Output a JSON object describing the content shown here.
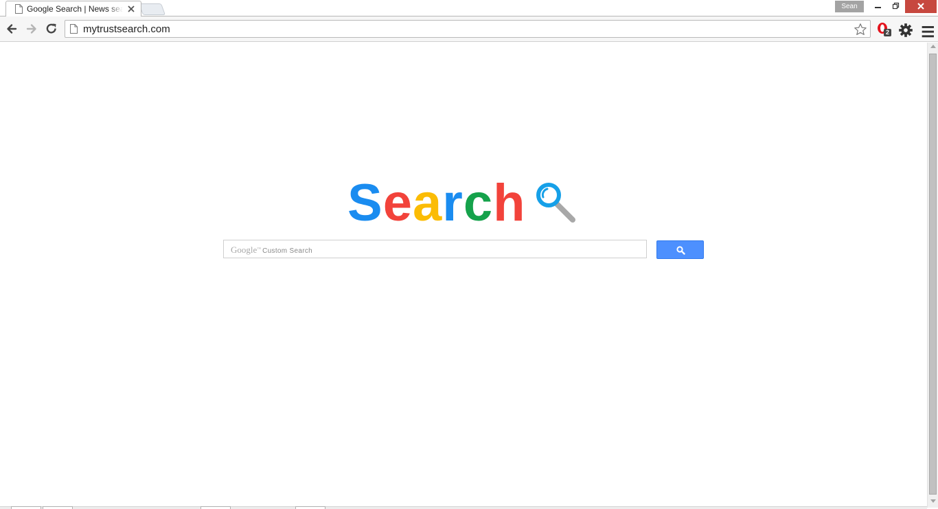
{
  "browser": {
    "tab": {
      "title": "Google Search | News search"
    },
    "profile_name": "Sean",
    "address": "mytrustsearch.com",
    "extension_badge": "2"
  },
  "page": {
    "logo": {
      "letters": [
        {
          "char": "S",
          "color": "#1a8cf0"
        },
        {
          "char": "e",
          "color": "#f2433b"
        },
        {
          "char": "a",
          "color": "#fbbc05"
        },
        {
          "char": "r",
          "color": "#1a8cf0"
        },
        {
          "char": "c",
          "color": "#15a24b"
        },
        {
          "char": "h",
          "color": "#f2433b"
        }
      ],
      "glass_ring_color": "#16a0e8",
      "glass_handle_color": "#a8a8a8"
    },
    "search": {
      "watermark_brand": "Google",
      "watermark_tm": "™",
      "watermark_label": "Custom Search",
      "button_icon": "search-icon",
      "button_color": "#4d90fe"
    }
  },
  "icons": {
    "back": "arrow-left-icon",
    "forward": "arrow-right-icon",
    "reload": "reload-icon",
    "bookmark": "star-icon",
    "extension": "opera-o-icon",
    "settings": "gear-icon",
    "menu": "hamburger-menu-icon"
  }
}
